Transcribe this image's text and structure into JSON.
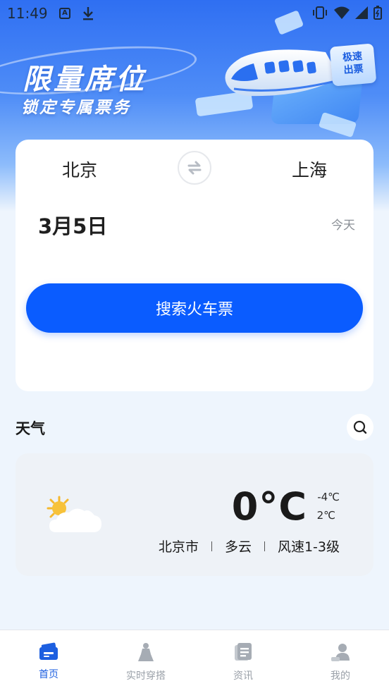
{
  "status_bar": {
    "time": "11:49",
    "a_icon": "A"
  },
  "banner": {
    "title": "限量席位",
    "subtitle": "锁定专属票务",
    "badge_line1": "极速",
    "badge_line2": "出票"
  },
  "booking": {
    "from_city": "北京",
    "to_city": "上海",
    "date": "3月5日",
    "day_label": "今天",
    "search_button": "搜索火车票"
  },
  "weather": {
    "section_title": "天气",
    "temperature": "0°C",
    "low": "-4℃",
    "high": "2℃",
    "city": "北京市",
    "condition": "多云",
    "wind": "风速1-3级"
  },
  "nav": {
    "items": [
      {
        "label": "首页",
        "icon": "ticket-icon",
        "active": true
      },
      {
        "label": "实时穿搭",
        "icon": "outfit-icon",
        "active": false
      },
      {
        "label": "资讯",
        "icon": "news-icon",
        "active": false
      },
      {
        "label": "我的",
        "icon": "profile-icon",
        "active": false
      }
    ]
  },
  "colors": {
    "accent": "#0a5cff",
    "nav_active": "#1d5fe0",
    "nav_inactive": "#9aa0a8"
  }
}
